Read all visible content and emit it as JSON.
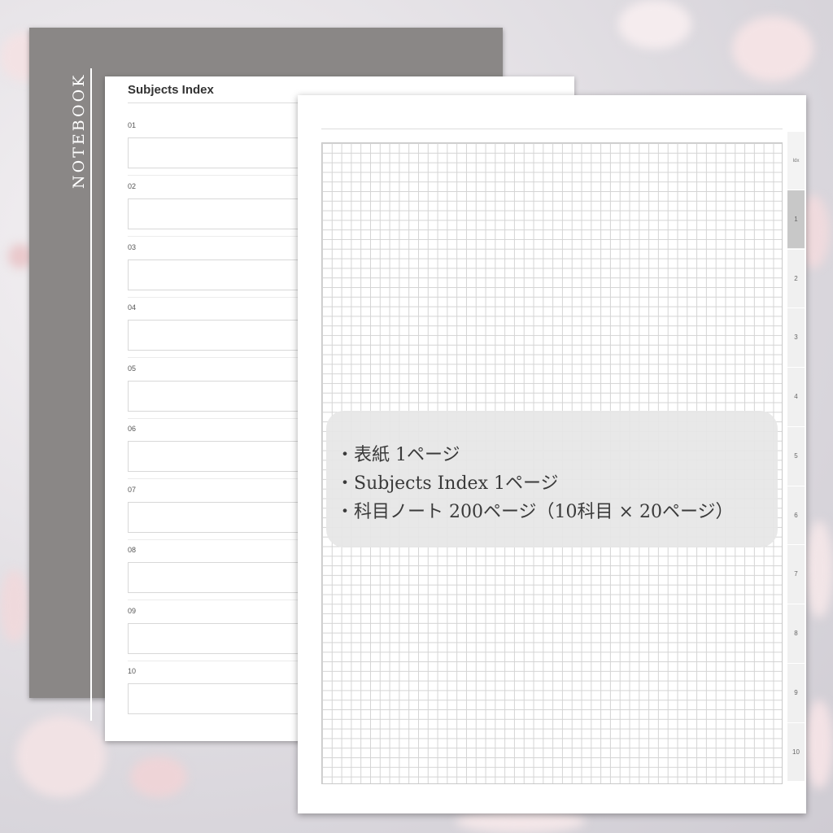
{
  "cover": {
    "title": "NOTEBOOK"
  },
  "index_page": {
    "title": "Subjects Index",
    "items": [
      "01",
      "02",
      "03",
      "04",
      "05",
      "06",
      "07",
      "08",
      "09",
      "10"
    ]
  },
  "grid_page": {
    "tabs_header": "Idx",
    "tabs": [
      "1",
      "2",
      "3",
      "4",
      "5",
      "6",
      "7",
      "8",
      "9",
      "10"
    ],
    "active_tab": "1"
  },
  "info": {
    "lines": [
      "・表紙 1ページ",
      "・Subjects Index 1ページ",
      "・科目ノート 200ページ（10科目 × 20ページ）"
    ]
  },
  "colors": {
    "cover": "#8a8786",
    "grid_line": "#d4d4d4",
    "active_tab": "#c8c8c8",
    "overlay": "#e6e6e6"
  }
}
